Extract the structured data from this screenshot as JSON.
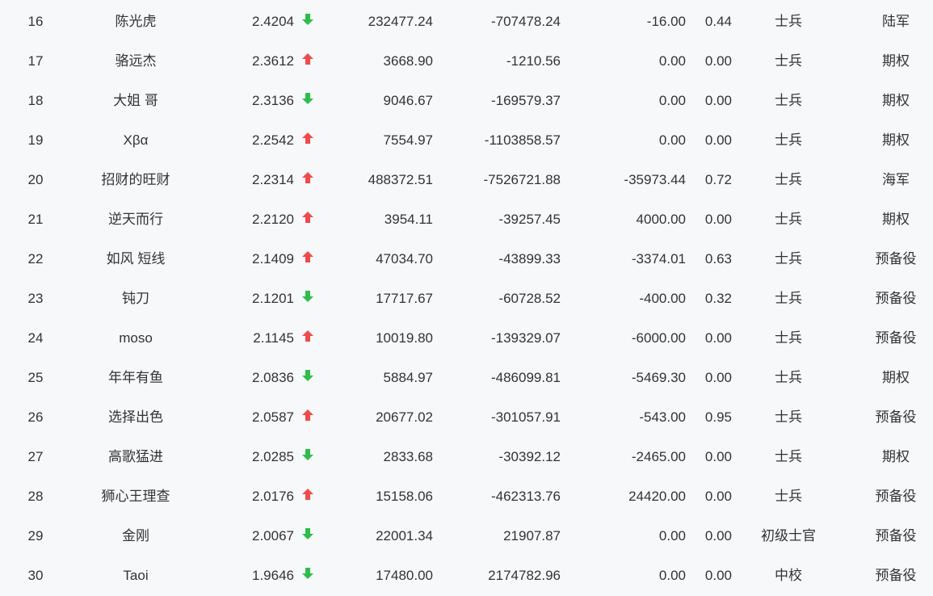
{
  "colors": {
    "background": "#f7f8fa",
    "text": "#333333",
    "up_arrow": "#f04a4a",
    "down_arrow": "#2ebd4a"
  },
  "rows": [
    {
      "rank": "16",
      "name": "陈光虎",
      "score": "2.4204",
      "trend": "down",
      "v1": "232477.24",
      "v2": "-707478.24",
      "v3": "-16.00",
      "v4": "0.44",
      "rank_title": "士兵",
      "type": "陆军"
    },
    {
      "rank": "17",
      "name": "骆远杰",
      "score": "2.3612",
      "trend": "up",
      "v1": "3668.90",
      "v2": "-1210.56",
      "v3": "0.00",
      "v4": "0.00",
      "rank_title": "士兵",
      "type": "期权"
    },
    {
      "rank": "18",
      "name": "大姐 哥",
      "score": "2.3136",
      "trend": "down",
      "v1": "9046.67",
      "v2": "-169579.37",
      "v3": "0.00",
      "v4": "0.00",
      "rank_title": "士兵",
      "type": "期权"
    },
    {
      "rank": "19",
      "name": "Xβα",
      "score": "2.2542",
      "trend": "up",
      "v1": "7554.97",
      "v2": "-1103858.57",
      "v3": "0.00",
      "v4": "0.00",
      "rank_title": "士兵",
      "type": "期权"
    },
    {
      "rank": "20",
      "name": "招财的旺财",
      "score": "2.2314",
      "trend": "up",
      "v1": "488372.51",
      "v2": "-7526721.88",
      "v3": "-35973.44",
      "v4": "0.72",
      "rank_title": "士兵",
      "type": "海军"
    },
    {
      "rank": "21",
      "name": "逆天而行",
      "score": "2.2120",
      "trend": "up",
      "v1": "3954.11",
      "v2": "-39257.45",
      "v3": "4000.00",
      "v4": "0.00",
      "rank_title": "士兵",
      "type": "期权"
    },
    {
      "rank": "22",
      "name": "如风 短线",
      "score": "2.1409",
      "trend": "up",
      "v1": "47034.70",
      "v2": "-43899.33",
      "v3": "-3374.01",
      "v4": "0.63",
      "rank_title": "士兵",
      "type": "预备役"
    },
    {
      "rank": "23",
      "name": "钝刀",
      "score": "2.1201",
      "trend": "down",
      "v1": "17717.67",
      "v2": "-60728.52",
      "v3": "-400.00",
      "v4": "0.32",
      "rank_title": "士兵",
      "type": "预备役"
    },
    {
      "rank": "24",
      "name": "moso",
      "score": "2.1145",
      "trend": "up",
      "v1": "10019.80",
      "v2": "-139329.07",
      "v3": "-6000.00",
      "v4": "0.00",
      "rank_title": "士兵",
      "type": "预备役"
    },
    {
      "rank": "25",
      "name": "年年有鱼",
      "score": "2.0836",
      "trend": "down",
      "v1": "5884.97",
      "v2": "-486099.81",
      "v3": "-5469.30",
      "v4": "0.00",
      "rank_title": "士兵",
      "type": "期权"
    },
    {
      "rank": "26",
      "name": "选择出色",
      "score": "2.0587",
      "trend": "up",
      "v1": "20677.02",
      "v2": "-301057.91",
      "v3": "-543.00",
      "v4": "0.95",
      "rank_title": "士兵",
      "type": "预备役"
    },
    {
      "rank": "27",
      "name": "高歌猛进",
      "score": "2.0285",
      "trend": "down",
      "v1": "2833.68",
      "v2": "-30392.12",
      "v3": "-2465.00",
      "v4": "0.00",
      "rank_title": "士兵",
      "type": "期权"
    },
    {
      "rank": "28",
      "name": "狮心王理查",
      "score": "2.0176",
      "trend": "up",
      "v1": "15158.06",
      "v2": "-462313.76",
      "v3": "24420.00",
      "v4": "0.00",
      "rank_title": "士兵",
      "type": "预备役"
    },
    {
      "rank": "29",
      "name": "金刚",
      "score": "2.0067",
      "trend": "down",
      "v1": "22001.34",
      "v2": "21907.87",
      "v3": "0.00",
      "v4": "0.00",
      "rank_title": "初级士官",
      "type": "预备役"
    },
    {
      "rank": "30",
      "name": "Taoi",
      "score": "1.9646",
      "trend": "down",
      "v1": "17480.00",
      "v2": "2174782.96",
      "v3": "0.00",
      "v4": "0.00",
      "rank_title": "中校",
      "type": "预备役"
    }
  ]
}
